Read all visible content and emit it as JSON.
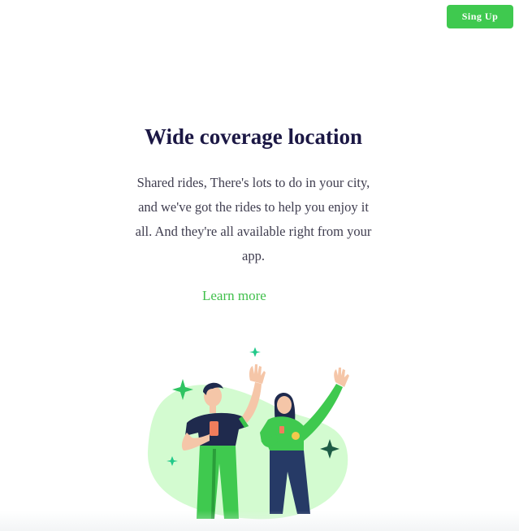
{
  "header": {
    "signup_label": "Sing Up"
  },
  "feature": {
    "title": "Wide coverage location",
    "description": "Shared rides, There's lots to do in your city, and we've got the rides to help you enjoy it all. And they're all available right from your app.",
    "link_label": "Learn more"
  },
  "colors": {
    "brand_green": "#3fc94f",
    "title_navy": "#1b1744",
    "body_text": "#3f3d4f",
    "blob_green": "#d3fbd0"
  },
  "illustration": {
    "icon": "people-celebrating-illustration"
  }
}
